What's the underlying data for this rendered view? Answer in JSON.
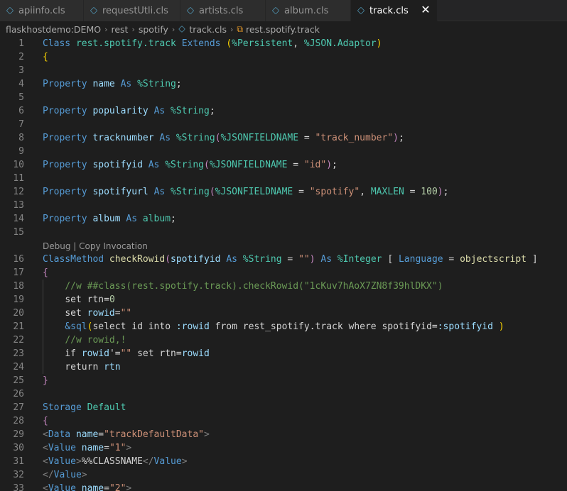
{
  "tabs": [
    {
      "label": "apiinfo.cls",
      "active": false
    },
    {
      "label": "requestUtli.cls",
      "active": false
    },
    {
      "label": "artists.cls",
      "active": false
    },
    {
      "label": "album.cls",
      "active": false
    },
    {
      "label": "track.cls",
      "active": true
    }
  ],
  "close_glyph": "✕",
  "breadcrumb": [
    "flaskhostdemo:DEMO",
    "rest",
    "spotify",
    "track.cls",
    "rest.spotify.track"
  ],
  "codelens": "Debug | Copy Invocation",
  "lines": [
    {
      "n": "1",
      "tokens": [
        [
          "k",
          "Class"
        ],
        [
          "o",
          " "
        ],
        [
          "t",
          "rest.spotify.track"
        ],
        [
          "o",
          " "
        ],
        [
          "k",
          "Extends"
        ],
        [
          "o",
          " "
        ],
        [
          "y",
          "("
        ],
        [
          "t",
          "%Persistent"
        ],
        [
          "o",
          ", "
        ],
        [
          "t",
          "%JSON.Adaptor"
        ],
        [
          "y",
          ")"
        ]
      ]
    },
    {
      "n": "2",
      "tokens": [
        [
          "y",
          "{"
        ]
      ]
    },
    {
      "n": "3",
      "tokens": []
    },
    {
      "n": "4",
      "tokens": [
        [
          "k",
          "Property"
        ],
        [
          "o",
          " "
        ],
        [
          "p",
          "name"
        ],
        [
          "o",
          " "
        ],
        [
          "k",
          "As"
        ],
        [
          "o",
          " "
        ],
        [
          "t",
          "%String"
        ],
        [
          "o",
          ";"
        ]
      ]
    },
    {
      "n": "5",
      "tokens": []
    },
    {
      "n": "6",
      "tokens": [
        [
          "k",
          "Property"
        ],
        [
          "o",
          " "
        ],
        [
          "p",
          "popularity"
        ],
        [
          "o",
          " "
        ],
        [
          "k",
          "As"
        ],
        [
          "o",
          " "
        ],
        [
          "t",
          "%String"
        ],
        [
          "o",
          ";"
        ]
      ]
    },
    {
      "n": "7",
      "tokens": []
    },
    {
      "n": "8",
      "tokens": [
        [
          "k",
          "Property"
        ],
        [
          "o",
          " "
        ],
        [
          "p",
          "tracknumber"
        ],
        [
          "o",
          " "
        ],
        [
          "k",
          "As"
        ],
        [
          "o",
          " "
        ],
        [
          "t",
          "%String"
        ],
        [
          "m",
          "("
        ],
        [
          "t",
          "%JSONFIELDNAME"
        ],
        [
          "o",
          " = "
        ],
        [
          "s",
          "\"track_number\""
        ],
        [
          "m",
          ")"
        ],
        [
          "o",
          ";"
        ]
      ]
    },
    {
      "n": "9",
      "tokens": []
    },
    {
      "n": "10",
      "tokens": [
        [
          "k",
          "Property"
        ],
        [
          "o",
          " "
        ],
        [
          "p",
          "spotifyid"
        ],
        [
          "o",
          " "
        ],
        [
          "k",
          "As"
        ],
        [
          "o",
          " "
        ],
        [
          "t",
          "%String"
        ],
        [
          "m",
          "("
        ],
        [
          "t",
          "%JSONFIELDNAME"
        ],
        [
          "o",
          " = "
        ],
        [
          "s",
          "\"id\""
        ],
        [
          "m",
          ")"
        ],
        [
          "o",
          ";"
        ]
      ]
    },
    {
      "n": "11",
      "tokens": []
    },
    {
      "n": "12",
      "tokens": [
        [
          "k",
          "Property"
        ],
        [
          "o",
          " "
        ],
        [
          "p",
          "spotifyurl"
        ],
        [
          "o",
          " "
        ],
        [
          "k",
          "As"
        ],
        [
          "o",
          " "
        ],
        [
          "t",
          "%String"
        ],
        [
          "m",
          "("
        ],
        [
          "t",
          "%JSONFIELDNAME"
        ],
        [
          "o",
          " = "
        ],
        [
          "s",
          "\"spotify\""
        ],
        [
          "o",
          ", "
        ],
        [
          "t",
          "MAXLEN"
        ],
        [
          "o",
          " = "
        ],
        [
          "n",
          "100"
        ],
        [
          "m",
          ")"
        ],
        [
          "o",
          ";"
        ]
      ]
    },
    {
      "n": "13",
      "tokens": []
    },
    {
      "n": "14",
      "tokens": [
        [
          "k",
          "Property"
        ],
        [
          "o",
          " "
        ],
        [
          "p",
          "album"
        ],
        [
          "o",
          " "
        ],
        [
          "k",
          "As"
        ],
        [
          "o",
          " "
        ],
        [
          "t",
          "album"
        ],
        [
          "o",
          ";"
        ]
      ]
    },
    {
      "n": "15",
      "tokens": []
    },
    {
      "lens": true
    },
    {
      "n": "16",
      "tokens": [
        [
          "k",
          "ClassMethod"
        ],
        [
          "o",
          " "
        ],
        [
          "f",
          "checkRowid"
        ],
        [
          "m",
          "("
        ],
        [
          "p",
          "spotifyid"
        ],
        [
          "o",
          " "
        ],
        [
          "k",
          "As"
        ],
        [
          "o",
          " "
        ],
        [
          "t",
          "%String"
        ],
        [
          "o",
          " = "
        ],
        [
          "s",
          "\"\""
        ],
        [
          "m",
          ")"
        ],
        [
          "o",
          " "
        ],
        [
          "k",
          "As"
        ],
        [
          "o",
          " "
        ],
        [
          "t",
          "%Integer"
        ],
        [
          "o",
          " [ "
        ],
        [
          "k",
          "Language"
        ],
        [
          "o",
          " = "
        ],
        [
          "f",
          "objectscript"
        ],
        [
          "o",
          " ]"
        ]
      ]
    },
    {
      "n": "17",
      "tokens": [
        [
          "m",
          "{"
        ]
      ]
    },
    {
      "n": "18",
      "tokens": [
        [
          "o",
          "    "
        ],
        [
          "c",
          "//w ##class(rest.spotify.track).checkRowid(\"1cKuv7hAoX7ZN8f39hlDKX\")"
        ]
      ]
    },
    {
      "n": "19",
      "tokens": [
        [
          "o",
          "    "
        ],
        [
          "o",
          "set rtn="
        ],
        [
          "n",
          "0"
        ]
      ]
    },
    {
      "n": "20",
      "tokens": [
        [
          "o",
          "    "
        ],
        [
          "o",
          "set "
        ],
        [
          "p",
          "rowid"
        ],
        [
          "o",
          "="
        ],
        [
          "s",
          "\"\""
        ]
      ]
    },
    {
      "n": "21",
      "tokens": [
        [
          "o",
          "    "
        ],
        [
          "k",
          "&sql"
        ],
        [
          "y",
          "("
        ],
        [
          "o",
          "select id into "
        ],
        [
          "p",
          ":rowid"
        ],
        [
          "o",
          " from rest_spotify.track where spotifyid="
        ],
        [
          "p",
          ":spotifyid"
        ],
        [
          "o",
          " "
        ],
        [
          "y",
          ")"
        ]
      ]
    },
    {
      "n": "22",
      "tokens": [
        [
          "o",
          "    "
        ],
        [
          "c",
          "//w rowid,!"
        ]
      ]
    },
    {
      "n": "23",
      "tokens": [
        [
          "o",
          "    "
        ],
        [
          "o",
          "if "
        ],
        [
          "p",
          "rowid"
        ],
        [
          "o",
          "'="
        ],
        [
          "s",
          "\"\""
        ],
        [
          "o",
          " set rtn="
        ],
        [
          "p",
          "rowid"
        ]
      ]
    },
    {
      "n": "24",
      "tokens": [
        [
          "o",
          "    "
        ],
        [
          "o",
          "return "
        ],
        [
          "p",
          "rtn"
        ]
      ]
    },
    {
      "n": "25",
      "tokens": [
        [
          "m",
          "}"
        ]
      ]
    },
    {
      "n": "26",
      "tokens": []
    },
    {
      "n": "27",
      "tokens": [
        [
          "k",
          "Storage"
        ],
        [
          "o",
          " "
        ],
        [
          "t",
          "Default"
        ]
      ]
    },
    {
      "n": "28",
      "tokens": [
        [
          "m",
          "{"
        ]
      ]
    },
    {
      "n": "29",
      "tokens": [
        [
          "gr",
          "<"
        ],
        [
          "tag",
          "Data"
        ],
        [
          "o",
          " "
        ],
        [
          "p",
          "name"
        ],
        [
          "o",
          "="
        ],
        [
          "s",
          "\"trackDefaultData\""
        ],
        [
          "gr",
          ">"
        ]
      ]
    },
    {
      "n": "30",
      "tokens": [
        [
          "gr",
          "<"
        ],
        [
          "tag",
          "Value"
        ],
        [
          "o",
          " "
        ],
        [
          "p",
          "name"
        ],
        [
          "o",
          "="
        ],
        [
          "s",
          "\"1\""
        ],
        [
          "gr",
          ">"
        ]
      ]
    },
    {
      "n": "31",
      "tokens": [
        [
          "gr",
          "<"
        ],
        [
          "tag",
          "Value"
        ],
        [
          "gr",
          ">"
        ],
        [
          "o",
          "%%CLASSNAME"
        ],
        [
          "gr",
          "</"
        ],
        [
          "tag",
          "Value"
        ],
        [
          "gr",
          ">"
        ]
      ]
    },
    {
      "n": "32",
      "tokens": [
        [
          "gr",
          "</"
        ],
        [
          "tag",
          "Value"
        ],
        [
          "gr",
          ">"
        ]
      ]
    },
    {
      "n": "33",
      "tokens": [
        [
          "gr",
          "<"
        ],
        [
          "tag",
          "Value"
        ],
        [
          "o",
          " "
        ],
        [
          "p",
          "name"
        ],
        [
          "o",
          "="
        ],
        [
          "s",
          "\"2\""
        ],
        [
          "gr",
          ">"
        ]
      ]
    }
  ]
}
